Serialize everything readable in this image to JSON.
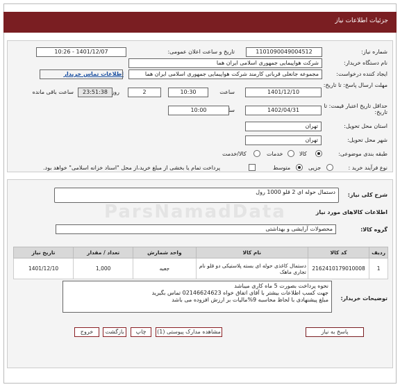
{
  "header": {
    "title": "جزئیات اطلاعات نیاز"
  },
  "form": {
    "need_number_label": "شماره نیاز:",
    "need_number": "1101090049004512",
    "announce_label": "تاریخ و ساعت اعلان عمومی:",
    "announce_value": "1401/12/07 - 10:26",
    "buyer_label": "نام دستگاه خریدار:",
    "buyer_value": "شرکت هواپیمایی جمهوری اسلامی ایران هما",
    "creator_label": "ایجاد کننده درخواست:",
    "creator_value": "مجموعه جانعلی قربانی کارمند شرکت هواپیمایی جمهوری اسلامی ایران هما",
    "contact_link": "اطلاعات تماس خریدار",
    "deadline_label": "مهلت ارسال پاسخ: تا تاریخ:",
    "deadline_date": "1401/12/10",
    "time_label": "ساعت",
    "deadline_time": "10:30",
    "days_value": "2",
    "days_label": "روز و",
    "remaining_time": "23:51:38",
    "remaining_label": "ساعت باقی مانده",
    "validity_label": "حداقل تاریخ اعتبار قیمت: تا تاریخ:",
    "validity_date": "1402/04/31",
    "validity_time": "10:00",
    "province_label": "استان محل تحویل:",
    "province_value": "تهران",
    "city_label": "شهر محل تحویل:",
    "city_value": "تهران",
    "category_label": "طبقه بندی موضوعی:",
    "category_options": [
      "کالا",
      "خدمات",
      "کالا/خدمت"
    ],
    "process_label": "نوع فرآیند خرید :",
    "process_options": [
      "جزیی",
      "متوسط"
    ],
    "payment_note": "پرداخت تمام یا بخشی از مبلغ خرید،از محل \"اسناد خزانه اسلامی\" خواهد بود."
  },
  "summary": {
    "label": "شرح کلی نیاز:",
    "value": "دستمال حوله ای 2 قلو  1000 رول"
  },
  "goods": {
    "section_title": "اطلاعات کالاهای مورد نیاز",
    "group_label": "گروه کالا:",
    "group_value": "محصولات آرایشی و بهداشتی",
    "columns": [
      "ردیف",
      "کد کالا",
      "نام کالا",
      "واحد شمارش",
      "تعداد / مقدار",
      "تاریخ نیاز"
    ],
    "rows": [
      [
        "1",
        "2162410179010008",
        "دستمال کاغذی حوله ای بسته پلاستیکی دو قلو نام تجاری ماهک",
        "جعبه",
        "1,000",
        "1401/12/10"
      ]
    ]
  },
  "buyer_notes": {
    "label": "توضیحات خریدار:",
    "lines": [
      "نحوه پرداخت بصورت 5 ماه کاری میباشد",
      "جهت کسب اطلاعات بیشتر با آقای اتفاق خواه  02146624623 تماس بگیرید",
      "مبلغ پیشنهادی با لحاظ محاسبه 9%مالیات بر ارزش افزوده می باشد"
    ]
  },
  "watermark": "ParsNamadData",
  "buttons": {
    "reply": "پاسخ به نیاز",
    "attachments": "مشاهده مدارک پیوستی (1)",
    "print": "چاپ",
    "back": "بازگشت",
    "exit": "خروج"
  }
}
